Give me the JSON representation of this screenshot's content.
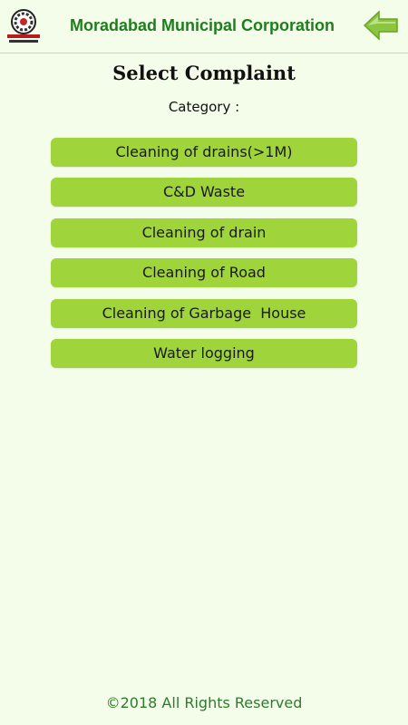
{
  "header": {
    "title": "Moradabad Municipal Corporation",
    "logo_icon": "municipal-emblem-icon",
    "back_icon": "arrow-left-icon"
  },
  "page": {
    "title": "Select Complaint",
    "category_label": "Category :"
  },
  "complaints": [
    {
      "label": "Cleaning of drains(>1M)"
    },
    {
      "label": "C&D Waste"
    },
    {
      "label": "Cleaning of drain"
    },
    {
      "label": "Cleaning of Road"
    },
    {
      "label": "Cleaning of Garbage  House"
    },
    {
      "label": "Water logging"
    }
  ],
  "footer": {
    "copyright": "©2018 All Rights Reserved"
  },
  "colors": {
    "background": "#f4fde9",
    "title_green": "#1e7e1e",
    "button_green": "#9fd53b",
    "footer_green": "#2d7a2d"
  }
}
